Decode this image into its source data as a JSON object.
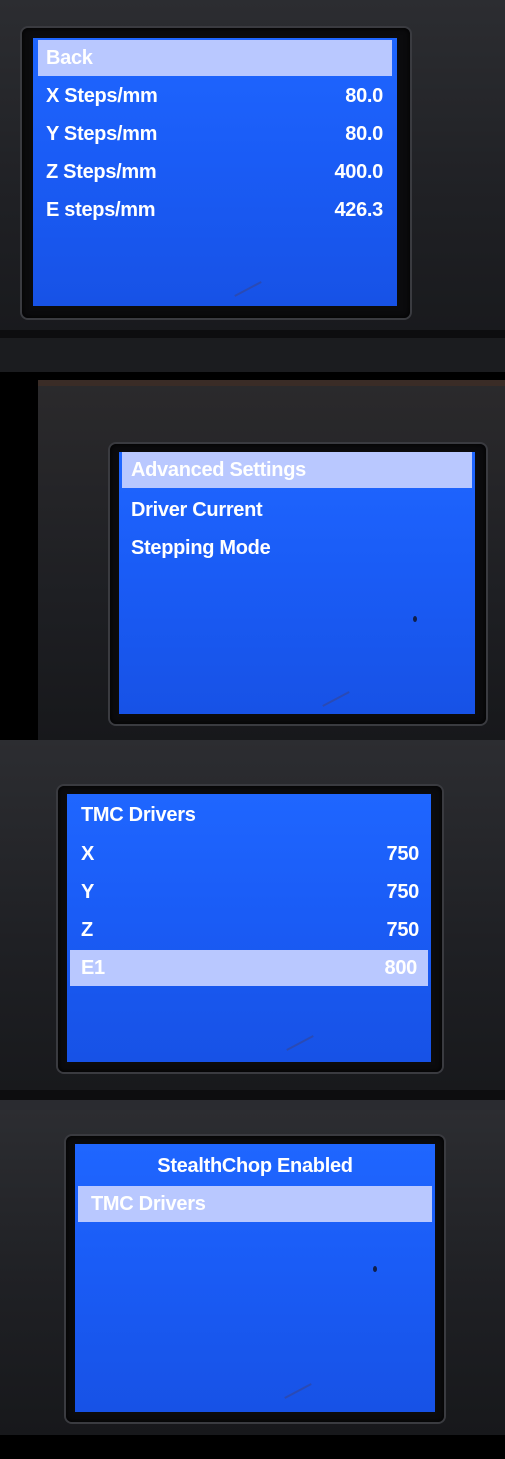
{
  "panels": [
    {
      "rows": [
        {
          "label": "Back",
          "value": "",
          "highlighted": true
        },
        {
          "label": "X Steps/mm",
          "value": "80.0",
          "highlighted": false
        },
        {
          "label": "Y Steps/mm",
          "value": "80.0",
          "highlighted": false
        },
        {
          "label": "Z Steps/mm",
          "value": "400.0",
          "highlighted": false
        },
        {
          "label": "E steps/mm",
          "value": "426.3",
          "highlighted": false
        }
      ]
    },
    {
      "rows": [
        {
          "label": "Advanced Settings",
          "highlighted": true
        },
        {
          "label": "Driver Current",
          "highlighted": false
        },
        {
          "label": "Stepping Mode",
          "highlighted": false
        }
      ]
    },
    {
      "title": "TMC Drivers",
      "rows": [
        {
          "label": "X",
          "value": "750",
          "highlighted": false
        },
        {
          "label": "Y",
          "value": "750",
          "highlighted": false
        },
        {
          "label": "Z",
          "value": "750",
          "highlighted": false
        },
        {
          "label": "E1",
          "value": "800",
          "highlighted": true
        }
      ]
    },
    {
      "title": "StealthChop Enabled",
      "rows": [
        {
          "label": "TMC Drivers",
          "highlighted": true
        }
      ]
    }
  ],
  "colors": {
    "screen": "#1a5cf6",
    "highlight": "#b9c8ff",
    "text": "#ffffff",
    "bezel": "#222327"
  }
}
